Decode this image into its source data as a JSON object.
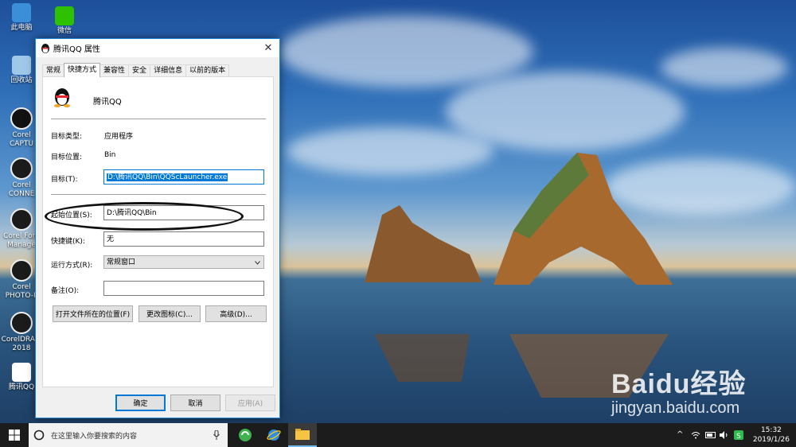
{
  "desktop": {
    "icons": [
      {
        "label": "此电脑",
        "color": "#3a8fd8"
      },
      {
        "label": "微信",
        "color": "#2dc100"
      },
      {
        "label": "回收站",
        "color": "#9fc7e8"
      },
      {
        "label": "Corel CAPTU",
        "color": "#111111"
      },
      {
        "label": "Corel CONNE",
        "color": "#1b1b1b"
      },
      {
        "label": "Corel Font Manage",
        "color": "#1b1b1b"
      },
      {
        "label": "Corel PHOTO-P",
        "color": "#1b1b1b"
      },
      {
        "label": "CorelDRAW 2018",
        "color": "#1b1b1b"
      },
      {
        "label": "腾讯QQ",
        "color": "#ffffff"
      }
    ],
    "watermark": {
      "logo": "Baidu经验",
      "url": "jingyan.baidu.com"
    }
  },
  "dialog": {
    "title": "腾讯QQ 属性",
    "close": "✕",
    "tabs": [
      "常规",
      "快捷方式",
      "兼容性",
      "安全",
      "详细信息",
      "以前的版本"
    ],
    "active_tab": "快捷方式",
    "app_name": "腾讯QQ",
    "target_type": {
      "label": "目标类型:",
      "value": "应用程序"
    },
    "target_location": {
      "label": "目标位置:",
      "value": "Bin"
    },
    "target": {
      "label": "目标(T):",
      "value": "D:\\腾讯QQ\\Bin\\QQScLauncher.exe"
    },
    "start_in": {
      "label": "起始位置(S):",
      "value": "D:\\腾讯QQ\\Bin"
    },
    "shortcut_key": {
      "label": "快捷键(K):",
      "value": "无"
    },
    "run": {
      "label": "运行方式(R):",
      "value": "常规窗口"
    },
    "comment": {
      "label": "备注(O):",
      "value": ""
    },
    "buttons": {
      "open_location": "打开文件所在的位置(F)",
      "change_icon": "更改图标(C)...",
      "advanced": "高级(D)..."
    },
    "footer": {
      "ok": "确定",
      "cancel": "取消",
      "apply": "应用(A)"
    }
  },
  "taskbar": {
    "search_placeholder": "在这里输入你要搜索的内容",
    "time": "15:32",
    "date": "2019/1/26",
    "tray_chevron": "^"
  }
}
